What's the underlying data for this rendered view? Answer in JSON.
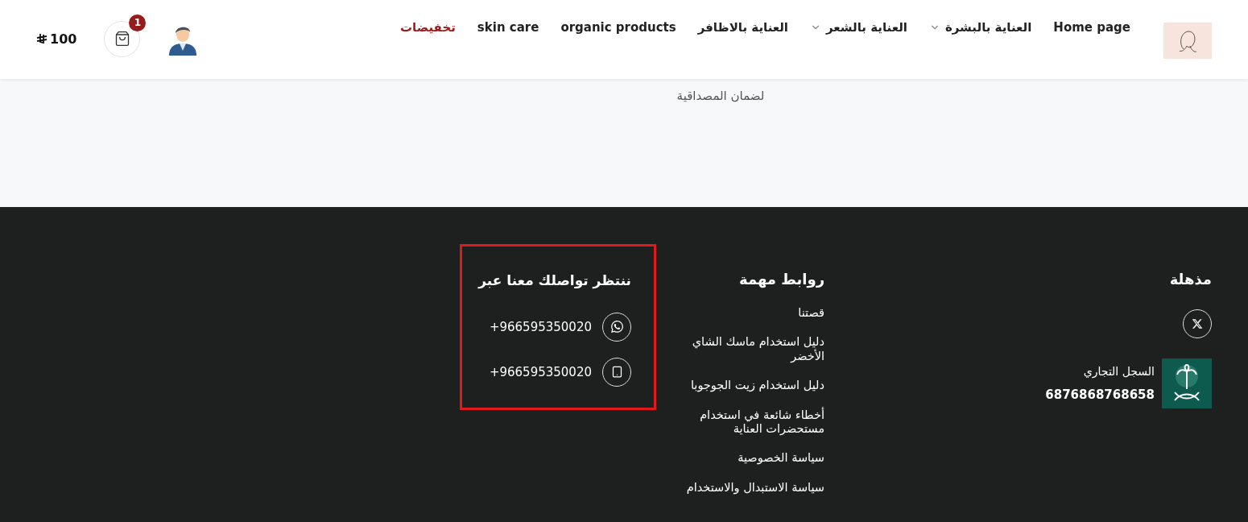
{
  "header": {
    "nav": [
      {
        "label": "Home page",
        "dropdown": false,
        "selected": false
      },
      {
        "label": "العناية بالبشرة",
        "dropdown": true,
        "selected": false
      },
      {
        "label": "العناية بالشعر",
        "dropdown": true,
        "selected": false
      },
      {
        "label": "العناية بالاظافر",
        "dropdown": false,
        "selected": false
      },
      {
        "label": "organic products",
        "dropdown": false,
        "selected": false
      },
      {
        "label": "skin care",
        "dropdown": false,
        "selected": false
      },
      {
        "label": "تخفيضات",
        "dropdown": false,
        "selected": true
      }
    ],
    "cart_count": "1",
    "cart_total": "100"
  },
  "intro": {
    "text": "لضمان المصداقية"
  },
  "footer": {
    "brand": {
      "title": "مذهلة",
      "register_label": "السجل التجاري",
      "register_number": "6876868768658"
    },
    "links": {
      "title": "روابط مهمة",
      "items": [
        "قصتنا",
        "دليل استخدام ماسك الشاي الأخضر",
        "دليل استخدام زيت الجوجوبا",
        "أخطاء شائعة في استخدام مستحضرات العناية",
        "سياسة الخصوصية",
        "سياسة الاستبدال والاستخدام"
      ]
    },
    "contact": {
      "title": "ننتظر تواصلك معنا عبر",
      "highlighted": true,
      "items": [
        {
          "kind": "whatsapp",
          "phone": "+966595350020"
        },
        {
          "kind": "mobile",
          "phone": "+966595350020"
        }
      ]
    }
  }
}
